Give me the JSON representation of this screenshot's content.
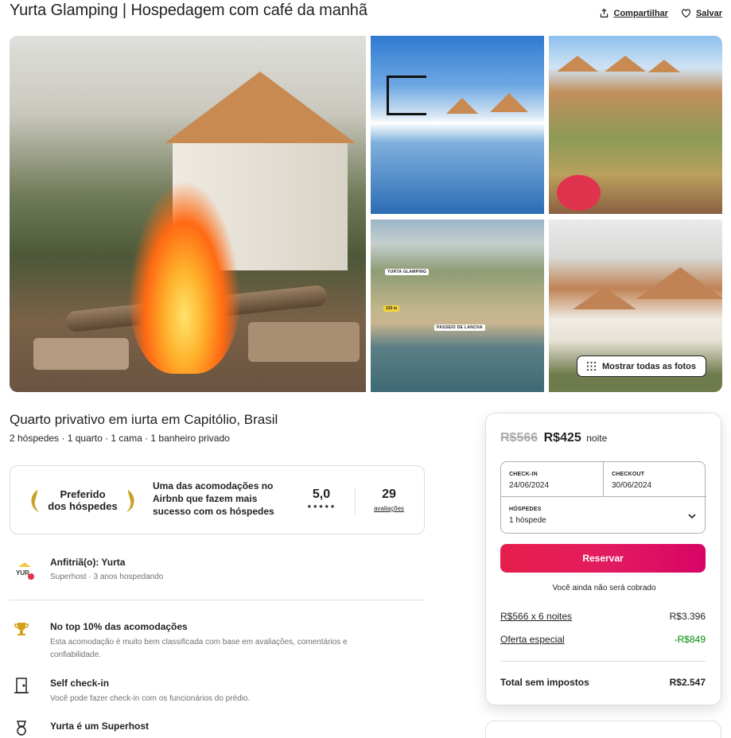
{
  "header": {
    "title": "Yurta Glamping | Hospedagem com café da manhã",
    "share_label": "Compartilhar",
    "save_label": "Salvar"
  },
  "gallery": {
    "show_all_label": "Mostrar todas as fotos",
    "aerial_labels": [
      "YURTA GLAMPING",
      "230 m",
      "PASSEIO DE LANCHA"
    ]
  },
  "listing": {
    "title": "Quarto privativo em iurta em Capitólio, Brasil",
    "subtitle": "2 hóspedes · 1 quarto · 1 cama · 1 banheiro privado"
  },
  "superhost_card": {
    "badge_line1": "Preferido",
    "badge_line2": "dos hóspedes",
    "description": "Uma das acomodações no Airbnb que fazem mais sucesso com os hóspedes",
    "rating": "5,0",
    "stars": "★★★★★",
    "reviews_count": "29",
    "reviews_label": "avaliações"
  },
  "host": {
    "name": "Anfitriã(o): Yurta",
    "details": "Superhost · 3 anos hospedando"
  },
  "features": [
    {
      "icon": "trophy-icon",
      "title": "No top 10% das acomodações",
      "description": "Esta acomodação é muito bem classificada com base em avaliações, comentários e confiabilidade."
    },
    {
      "icon": "door-icon",
      "title": "Self check-in",
      "description": "Você pode fazer check-in com os funcionários do prédio."
    },
    {
      "icon": "medal-icon",
      "title": "Yurta é um Superhost",
      "description": ""
    }
  ],
  "booking": {
    "old_price": "R$566",
    "new_price": "R$425",
    "per": "noite",
    "checkin_label": "CHECK-IN",
    "checkin_value": "24/06/2024",
    "checkout_label": "CHECKOUT",
    "checkout_value": "30/06/2024",
    "guests_label": "HÓSPEDES",
    "guests_value": "1 hóspede",
    "reserve_label": "Reservar",
    "notice": "Você ainda não será cobrado",
    "line1_label": "R$566 x 6 noites",
    "line1_value": "R$3.396",
    "line2_label": "Oferta especial",
    "line2_value": "-R$849",
    "total_label": "Total sem impostos",
    "total_value": "R$2.547"
  },
  "colors": {
    "accent": "#e31c5f",
    "discount": "#008a05",
    "text": "#222222",
    "muted": "#717171"
  }
}
